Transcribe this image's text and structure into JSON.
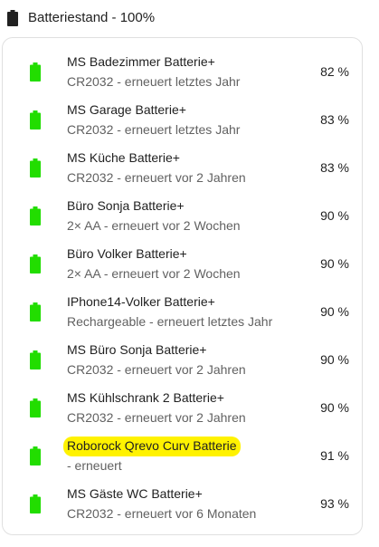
{
  "header": {
    "icon": "battery-full-icon",
    "title": "Batteriestand - 100%"
  },
  "colors": {
    "battery_green": "#22dd00",
    "highlight_yellow": "#fff200"
  },
  "items": [
    {
      "name": "MS Badezimmer Batterie+",
      "detail": "CR2032 - erneuert letztes Jahr",
      "value": "82 %",
      "icon": "battery-icon"
    },
    {
      "name": "MS Garage Batterie+",
      "detail": "CR2032 - erneuert letztes Jahr",
      "value": "83 %",
      "icon": "battery-icon"
    },
    {
      "name": "MS Küche Batterie+",
      "detail": "CR2032 - erneuert vor 2 Jahren",
      "value": "83 %",
      "icon": "battery-icon"
    },
    {
      "name": "Büro Sonja Batterie+",
      "detail": "2× AA - erneuert vor 2 Wochen",
      "value": "90 %",
      "icon": "battery-icon"
    },
    {
      "name": "Büro Volker Batterie+",
      "detail": "2× AA - erneuert vor 2 Wochen",
      "value": "90 %",
      "icon": "battery-icon"
    },
    {
      "name": "IPhone14-Volker Batterie+",
      "detail": "Rechargeable - erneuert letztes Jahr",
      "value": "90 %",
      "icon": "battery-icon"
    },
    {
      "name": "MS Büro Sonja Batterie+",
      "detail": "CR2032 - erneuert vor 2 Jahren",
      "value": "90 %",
      "icon": "battery-icon"
    },
    {
      "name": "MS Kühlschrank 2 Batterie+",
      "detail": "CR2032 - erneuert vor 2 Jahren",
      "value": "90 %",
      "icon": "battery-icon"
    },
    {
      "name": "Roborock Qrevo Curv Batterie",
      "detail": "- erneuert",
      "value": "91 %",
      "icon": "battery-icon"
    },
    {
      "name": "MS Gäste WC Batterie+",
      "detail": "CR2032 - erneuert vor 6 Monaten",
      "value": "93 %",
      "icon": "battery-icon"
    }
  ]
}
